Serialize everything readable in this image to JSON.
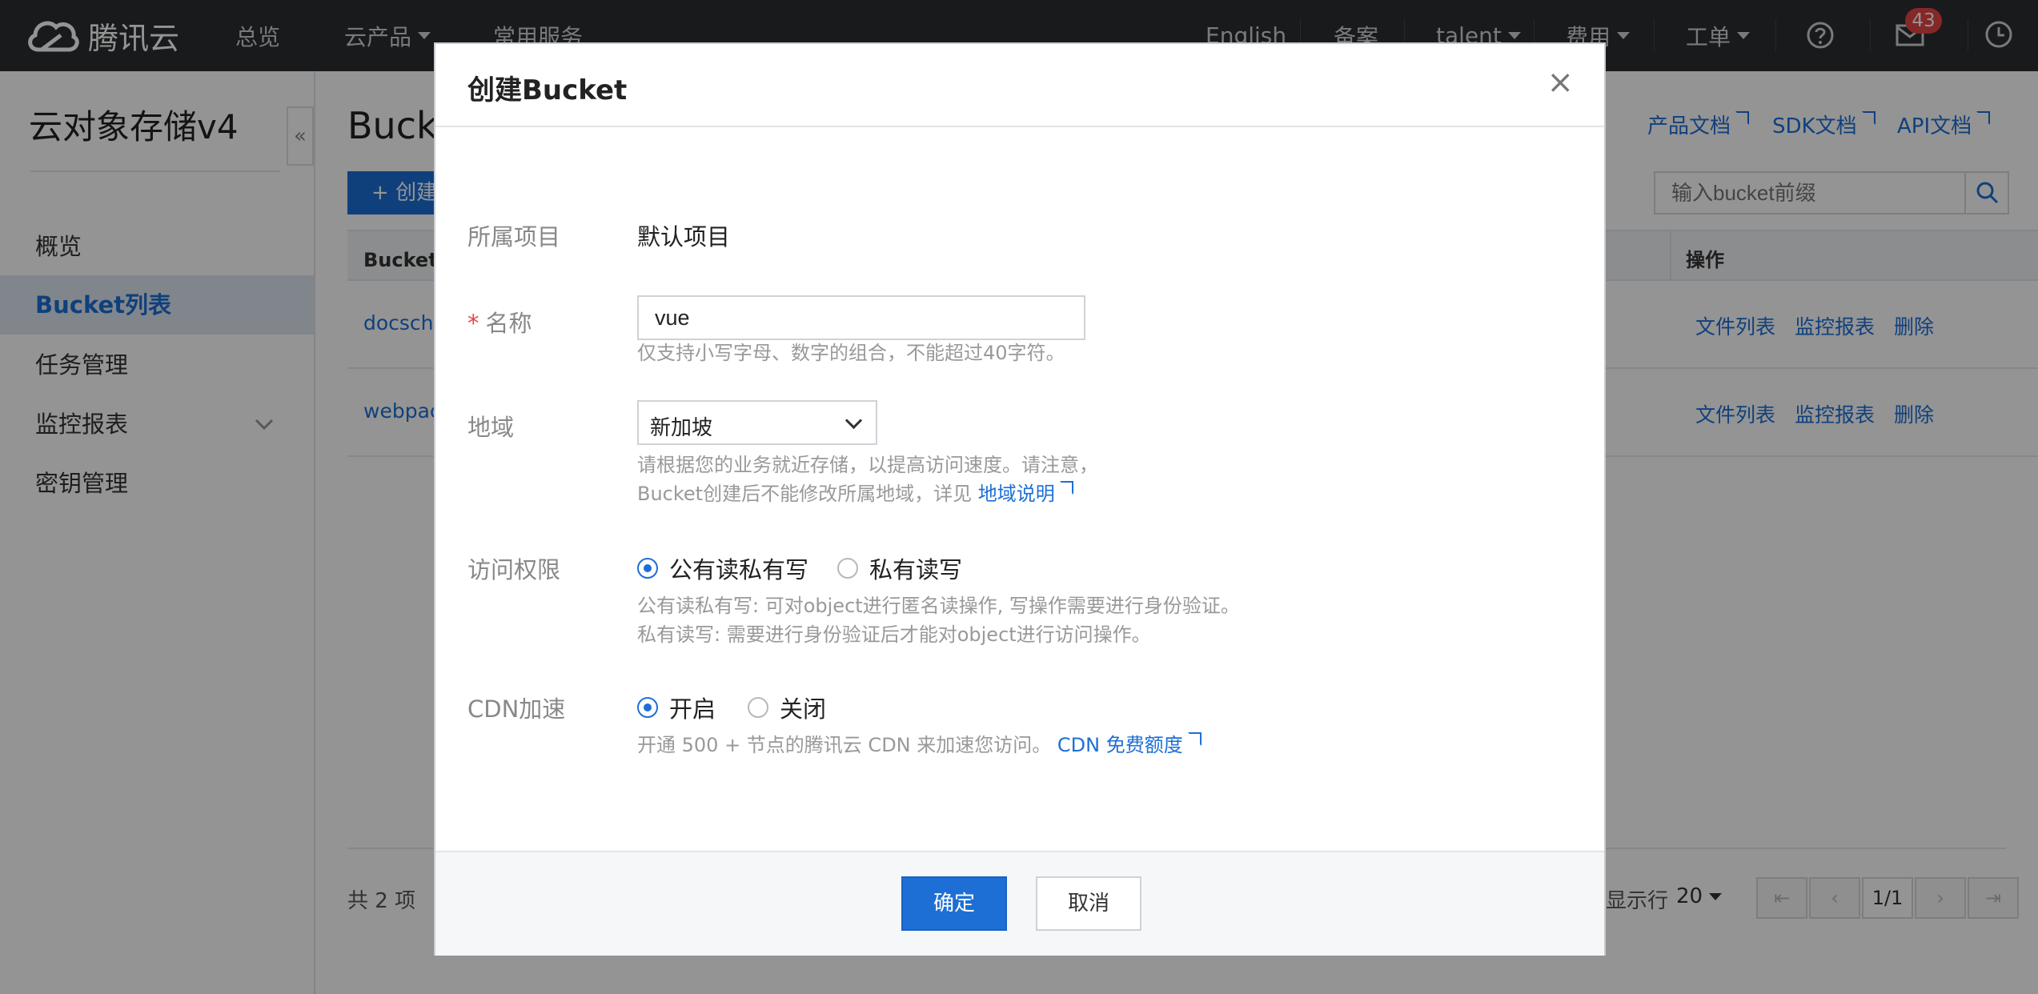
{
  "topbar": {
    "brand": "腾讯云",
    "nav": [
      "总览",
      "云产品",
      "常用服务"
    ],
    "right": {
      "language": "English",
      "beian": "备案",
      "user": "talent",
      "billing": "费用",
      "ticket": "工单",
      "message_count": "43"
    }
  },
  "sidebar": {
    "title": "云对象存储v4",
    "items": [
      {
        "label": "概览"
      },
      {
        "label": "Bucket列表"
      },
      {
        "label": "任务管理"
      },
      {
        "label": "监控报表"
      },
      {
        "label": "密钥管理"
      }
    ]
  },
  "main": {
    "title": "Bucket列表",
    "doc_links": [
      "产品文档",
      "SDK文档",
      "API文档"
    ],
    "create_label": "创建",
    "search_placeholder": "输入bucket前缀",
    "table": {
      "col_name": "Bucket名称",
      "col_ops": "操作",
      "rows": [
        {
          "name": "docschina",
          "ops": [
            "文件列表",
            "监控报表",
            "删除"
          ]
        },
        {
          "name": "webpack",
          "ops": [
            "文件列表",
            "监控报表",
            "删除"
          ]
        }
      ]
    },
    "footer": {
      "total": "共 2 项",
      "per_page_label": "每页显示行",
      "per_page": "20",
      "page": "1/1"
    }
  },
  "modal": {
    "title": "创建Bucket",
    "project": {
      "label": "所属项目",
      "value": "默认项目"
    },
    "name": {
      "label": "名称",
      "value": "vue",
      "hint": "仅支持小写字母、数字的组合，不能超过40字符。"
    },
    "region": {
      "label": "地域",
      "value": "新加坡",
      "hint_line1": "请根据您的业务就近存储，以提高访问速度。请注意，",
      "hint_line2": "Bucket创建后不能修改所属地域，详见",
      "hint_link": "地域说明"
    },
    "access": {
      "label": "访问权限",
      "options": [
        "公有读私有写",
        "私有读写"
      ],
      "selected": "公有读私有写",
      "hint_line1": "公有读私有写: 可对object进行匿名读操作, 写操作需要进行身份验证。",
      "hint_line2": "私有读写: 需要进行身份验证后才能对object进行访问操作。"
    },
    "cdn": {
      "label": "CDN加速",
      "options": [
        "开启",
        "关闭"
      ],
      "selected": "开启",
      "hint": "开通 500 + 节点的腾讯云 CDN 来加速您访问。",
      "hint_link": "CDN 免费额度"
    },
    "ok_label": "确定",
    "cancel_label": "取消"
  },
  "colors": {
    "accent": "#1d6fd6",
    "topbar": "#2b2d31",
    "badge": "#e54545",
    "overlay": "rgba(0,0,0,0.42)"
  }
}
